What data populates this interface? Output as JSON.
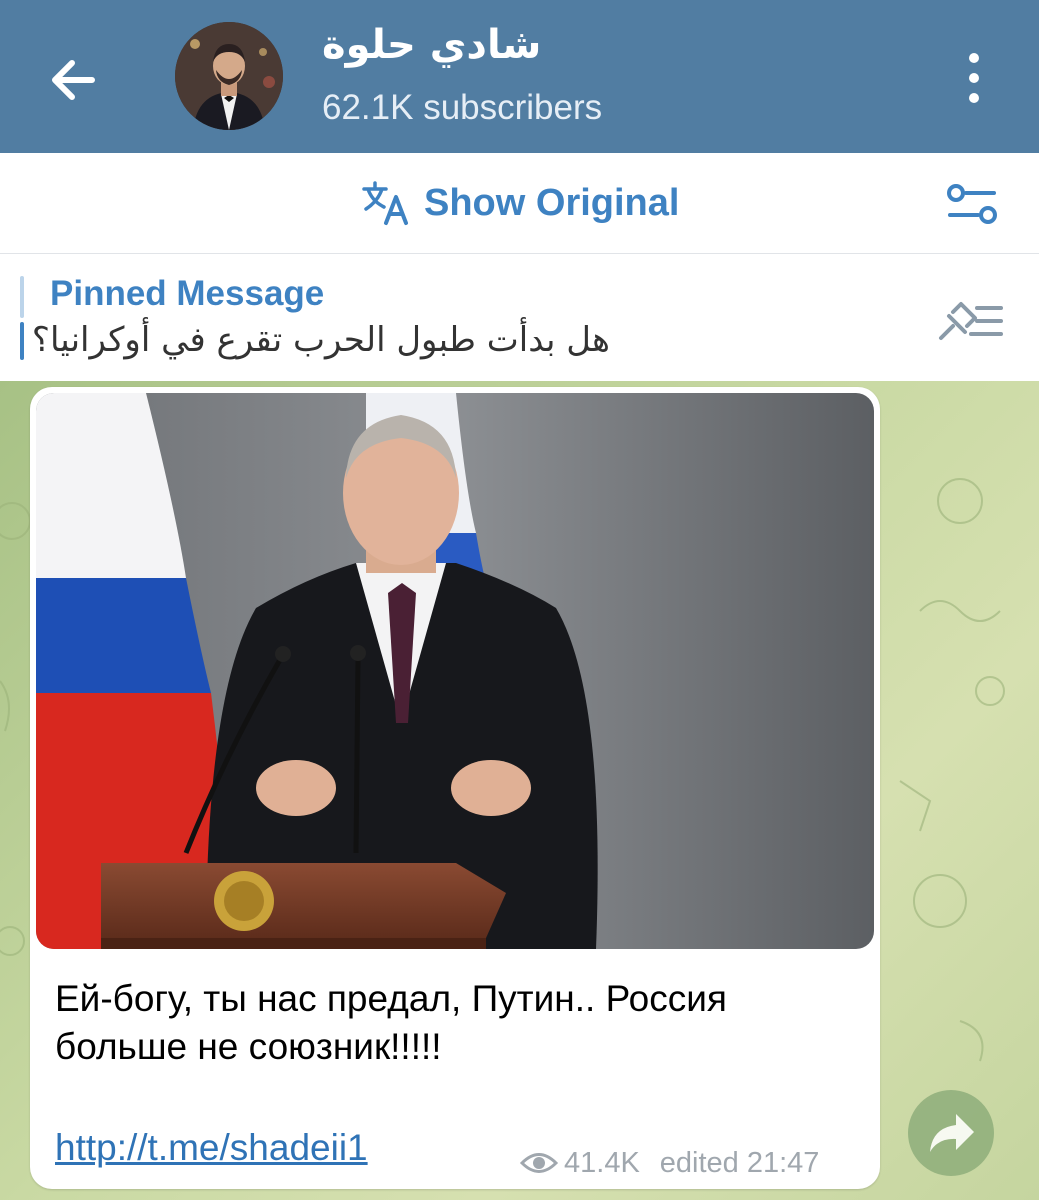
{
  "header": {
    "channel_name": "شادي حلوة",
    "subscribers": "62.1K subscribers",
    "bg_color": "#517da2"
  },
  "translate_bar": {
    "label": "Show Original",
    "accent": "#3e82c2"
  },
  "pinned": {
    "label": "Pinned Message",
    "text": "هل بدأت طبول الحرب تقرع في أوكرانيا؟"
  },
  "message": {
    "text": "Ей-богу, ты нас предал, Путин.. Россия больше не союзник!!!!!",
    "link": "http://t.me/shadeii1",
    "views": "41.4K",
    "edited": "edited 21:47"
  },
  "icons": [
    "back-arrow-icon",
    "more-vert-icon",
    "translate-icon",
    "translate-settings-icon",
    "pinned-list-icon",
    "eye-icon",
    "share-arrow-icon"
  ]
}
